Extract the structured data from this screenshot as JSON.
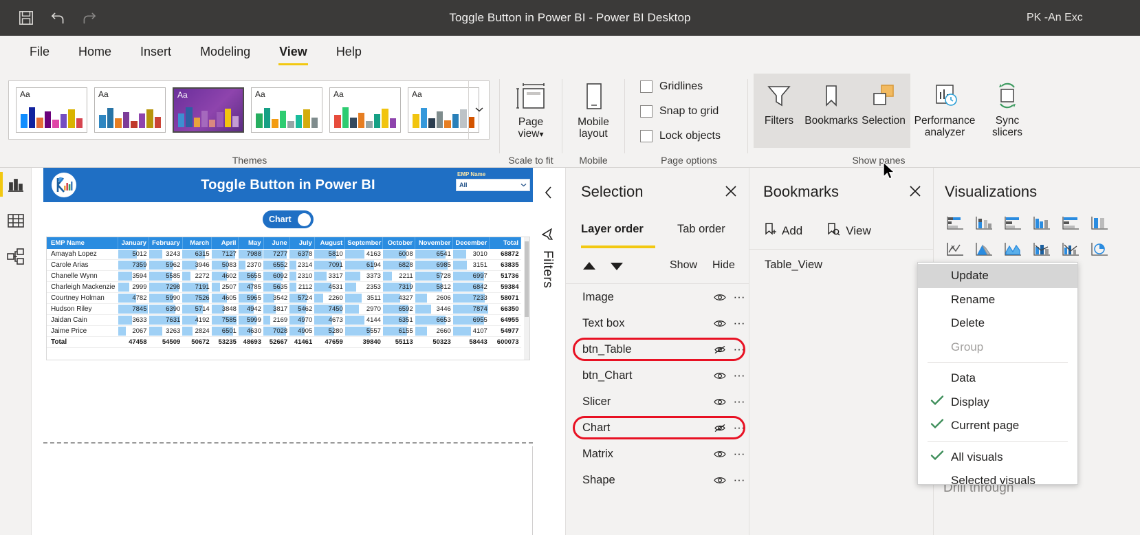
{
  "titlebar": {
    "title": "Toggle Button in Power BI - Power BI Desktop",
    "account": "PK -An Exc",
    "icons": [
      "save-icon",
      "undo-icon",
      "redo-icon"
    ]
  },
  "ribbon_tabs": [
    {
      "label": "File",
      "active": false
    },
    {
      "label": "Home",
      "active": false
    },
    {
      "label": "Insert",
      "active": false
    },
    {
      "label": "Modeling",
      "active": false
    },
    {
      "label": "View",
      "active": true
    },
    {
      "label": "Help",
      "active": false
    }
  ],
  "ribbon": {
    "themes": {
      "group_label": "Themes",
      "cards": [
        "Aa",
        "Aa",
        "Aa",
        "Aa",
        "Aa",
        "Aa"
      ],
      "selected_index": 2,
      "more_label": "chevron-down-icon"
    },
    "scale_to_fit": {
      "group_label": "Scale to fit",
      "page_view_label_line1": "Page",
      "page_view_label_line2": "view"
    },
    "mobile": {
      "group_label": "Mobile",
      "mobile_layout_line1": "Mobile",
      "mobile_layout_line2": "layout"
    },
    "page_options": {
      "group_label": "Page options",
      "checkboxes": [
        {
          "label": "Gridlines",
          "checked": false
        },
        {
          "label": "Snap to grid",
          "checked": false
        },
        {
          "label": "Lock objects",
          "checked": false
        }
      ]
    },
    "show_panes": {
      "group_label": "Show panes",
      "buttons": [
        {
          "label": "Filters",
          "icon": "filter-funnel-icon",
          "active": false
        },
        {
          "label": "Bookmarks",
          "icon": "bookmark-icon",
          "active": false
        },
        {
          "label": "Selection",
          "icon": "selection-pane-icon",
          "active": true
        },
        {
          "label": "Performance analyzer",
          "icon": "performance-analyzer-icon",
          "active": false
        },
        {
          "label": "Sync slicers",
          "icon": "sync-slicers-icon",
          "active": false
        }
      ]
    }
  },
  "left_nav": [
    {
      "icon": "report-view-icon",
      "selected": true
    },
    {
      "icon": "data-view-icon",
      "selected": false
    },
    {
      "icon": "model-view-icon",
      "selected": false
    }
  ],
  "report": {
    "header_title": "Toggle Button in Power BI",
    "slicer_label": "EMP Name",
    "slicer_value": "All",
    "toggle_label": "Chart",
    "columns": [
      "EMP Name",
      "January",
      "February",
      "March",
      "April",
      "May",
      "June",
      "July",
      "August",
      "September",
      "October",
      "November",
      "December",
      "Total"
    ],
    "rows": [
      {
        "name": "Amayah Lopez",
        "values": [
          5012,
          3243,
          6315,
          7127,
          7988,
          7277,
          6378,
          5810,
          4163,
          6008,
          6541,
          3010
        ],
        "total": 68872
      },
      {
        "name": "Carole Arias",
        "values": [
          7359,
          5962,
          3946,
          5083,
          2370,
          6552,
          2314,
          7091,
          6194,
          6828,
          6985,
          3151
        ],
        "total": 63835
      },
      {
        "name": "Chanelle Wynn",
        "values": [
          3594,
          5585,
          2272,
          4602,
          5655,
          6092,
          2310,
          3317,
          3373,
          2211,
          5728,
          6997
        ],
        "total": 51736
      },
      {
        "name": "Charleigh Mackenzie",
        "values": [
          2999,
          7298,
          7191,
          2507,
          4785,
          5635,
          2112,
          4531,
          2353,
          7319,
          5812,
          6842
        ],
        "total": 59384
      },
      {
        "name": "Courtney Holman",
        "values": [
          4782,
          5990,
          7526,
          4605,
          5965,
          3542,
          5724,
          2260,
          3511,
          4327,
          2606,
          7233
        ],
        "total": 58071
      },
      {
        "name": "Hudson Riley",
        "values": [
          7845,
          6390,
          5714,
          3848,
          4942,
          3817,
          5462,
          7450,
          2970,
          6592,
          3446,
          7874
        ],
        "total": 66350
      },
      {
        "name": "Jaidan Cain",
        "values": [
          3633,
          7631,
          4192,
          7585,
          5999,
          2169,
          4970,
          4673,
          4144,
          6351,
          6653,
          6955
        ],
        "total": 64955
      },
      {
        "name": "Jaime Price",
        "values": [
          2067,
          3263,
          2824,
          6501,
          4630,
          7028,
          4905,
          5280,
          5557,
          6155,
          2660,
          4107
        ],
        "total": 54977
      }
    ],
    "total_row": {
      "name": "Total",
      "values": [
        47458,
        54509,
        50672,
        53235,
        48693,
        52667,
        41461,
        47659,
        39840,
        55113,
        50323,
        58443
      ],
      "total": 600073
    }
  },
  "filters_rail": {
    "collapse_icon": "chevron-left-icon",
    "filter_icon": "filter-icon",
    "label": "Filters"
  },
  "selection_pane": {
    "title": "Selection",
    "close_icon": "close-icon",
    "tabs": [
      {
        "label": "Layer order",
        "active": true
      },
      {
        "label": "Tab order",
        "active": false
      }
    ],
    "sort_up_icon": "sort-up-icon",
    "sort_down_icon": "sort-down-icon",
    "show_label": "Show",
    "hide_label": "Hide",
    "items": [
      {
        "label": "Image",
        "hidden": false,
        "highlighted": false
      },
      {
        "label": "Text box",
        "hidden": false,
        "highlighted": false
      },
      {
        "label": "btn_Table",
        "hidden": true,
        "highlighted": true
      },
      {
        "label": "btn_Chart",
        "hidden": false,
        "highlighted": false
      },
      {
        "label": "Slicer",
        "hidden": false,
        "highlighted": false
      },
      {
        "label": "Chart",
        "hidden": true,
        "highlighted": true
      },
      {
        "label": "Matrix",
        "hidden": false,
        "highlighted": false
      },
      {
        "label": "Shape",
        "hidden": false,
        "highlighted": false
      }
    ]
  },
  "bookmarks_pane": {
    "title": "Bookmarks",
    "close_icon": "close-icon",
    "add_label": "Add",
    "view_label": "View",
    "items": [
      "Table_View"
    ]
  },
  "visualizations_pane": {
    "title": "Visualizations",
    "subtitle": "Drill through",
    "icons": [
      "stacked-bar-chart-icon",
      "stacked-column-chart-icon",
      "clustered-bar-chart-icon",
      "clustered-column-chart-icon",
      "100-stacked-bar-chart-icon",
      "100-stacked-column-chart-icon",
      "line-chart-icon",
      "area-chart-icon",
      "stacked-area-chart-icon",
      "line-stacked-column-chart-icon",
      "line-clustered-column-chart-icon",
      "ribbon-chart-icon"
    ]
  },
  "context_menu": {
    "items": [
      {
        "label": "Update",
        "checked": false,
        "disabled": false,
        "highlighted": true,
        "separator_after": false
      },
      {
        "label": "Rename",
        "checked": false,
        "disabled": false,
        "highlighted": false,
        "separator_after": false
      },
      {
        "label": "Delete",
        "checked": false,
        "disabled": false,
        "highlighted": false,
        "separator_after": false
      },
      {
        "label": "Group",
        "checked": false,
        "disabled": true,
        "highlighted": false,
        "separator_after": true
      },
      {
        "label": "Data",
        "checked": false,
        "disabled": false,
        "highlighted": false,
        "separator_after": false
      },
      {
        "label": "Display",
        "checked": true,
        "disabled": false,
        "highlighted": false,
        "separator_after": false
      },
      {
        "label": "Current page",
        "checked": true,
        "disabled": false,
        "highlighted": false,
        "separator_after": true
      },
      {
        "label": "All visuals",
        "checked": true,
        "disabled": false,
        "highlighted": false,
        "separator_after": false
      },
      {
        "label": "Selected visuals",
        "checked": false,
        "disabled": false,
        "highlighted": false,
        "separator_after": false
      }
    ]
  },
  "colors": {
    "titlebar_bg": "#3b3a39",
    "ribbon_bg": "#f3f2f1",
    "accent_yellow": "#f2c811",
    "report_blue": "#1f6fc4",
    "table_header_blue": "#2a8ce0",
    "data_bar_blue": "#9fd0f5",
    "highlight_red": "#e81123",
    "check_green": "#3e8e5a"
  }
}
